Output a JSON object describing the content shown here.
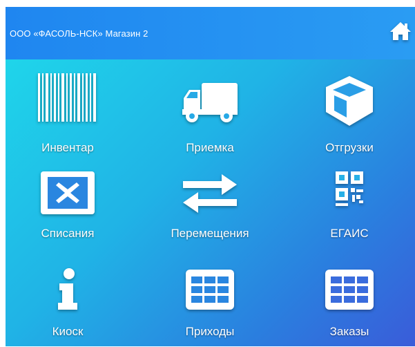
{
  "header": {
    "title": "ООО «ФАСОЛЬ-НСК» Магазин 2",
    "home_icon": "home-icon"
  },
  "tiles": [
    {
      "label": "Инвентар",
      "icon": "barcode-icon"
    },
    {
      "label": "Приемка",
      "icon": "truck-icon"
    },
    {
      "label": "Отгрузки",
      "icon": "box-icon"
    },
    {
      "label": "Списания",
      "icon": "close-box-icon"
    },
    {
      "label": "Перемещения",
      "icon": "transfer-arrows-icon"
    },
    {
      "label": "ЕГАИС",
      "icon": "qr-code-icon"
    },
    {
      "label": "Киоск",
      "icon": "info-icon"
    },
    {
      "label": "Приходы",
      "icon": "table-icon"
    },
    {
      "label": "Заказы",
      "icon": "table-icon"
    }
  ],
  "colors": {
    "header_bg": "#1f86f0",
    "gradient_start": "#1fd5ea",
    "gradient_end": "#3a5cd9",
    "icon": "#ffffff"
  }
}
